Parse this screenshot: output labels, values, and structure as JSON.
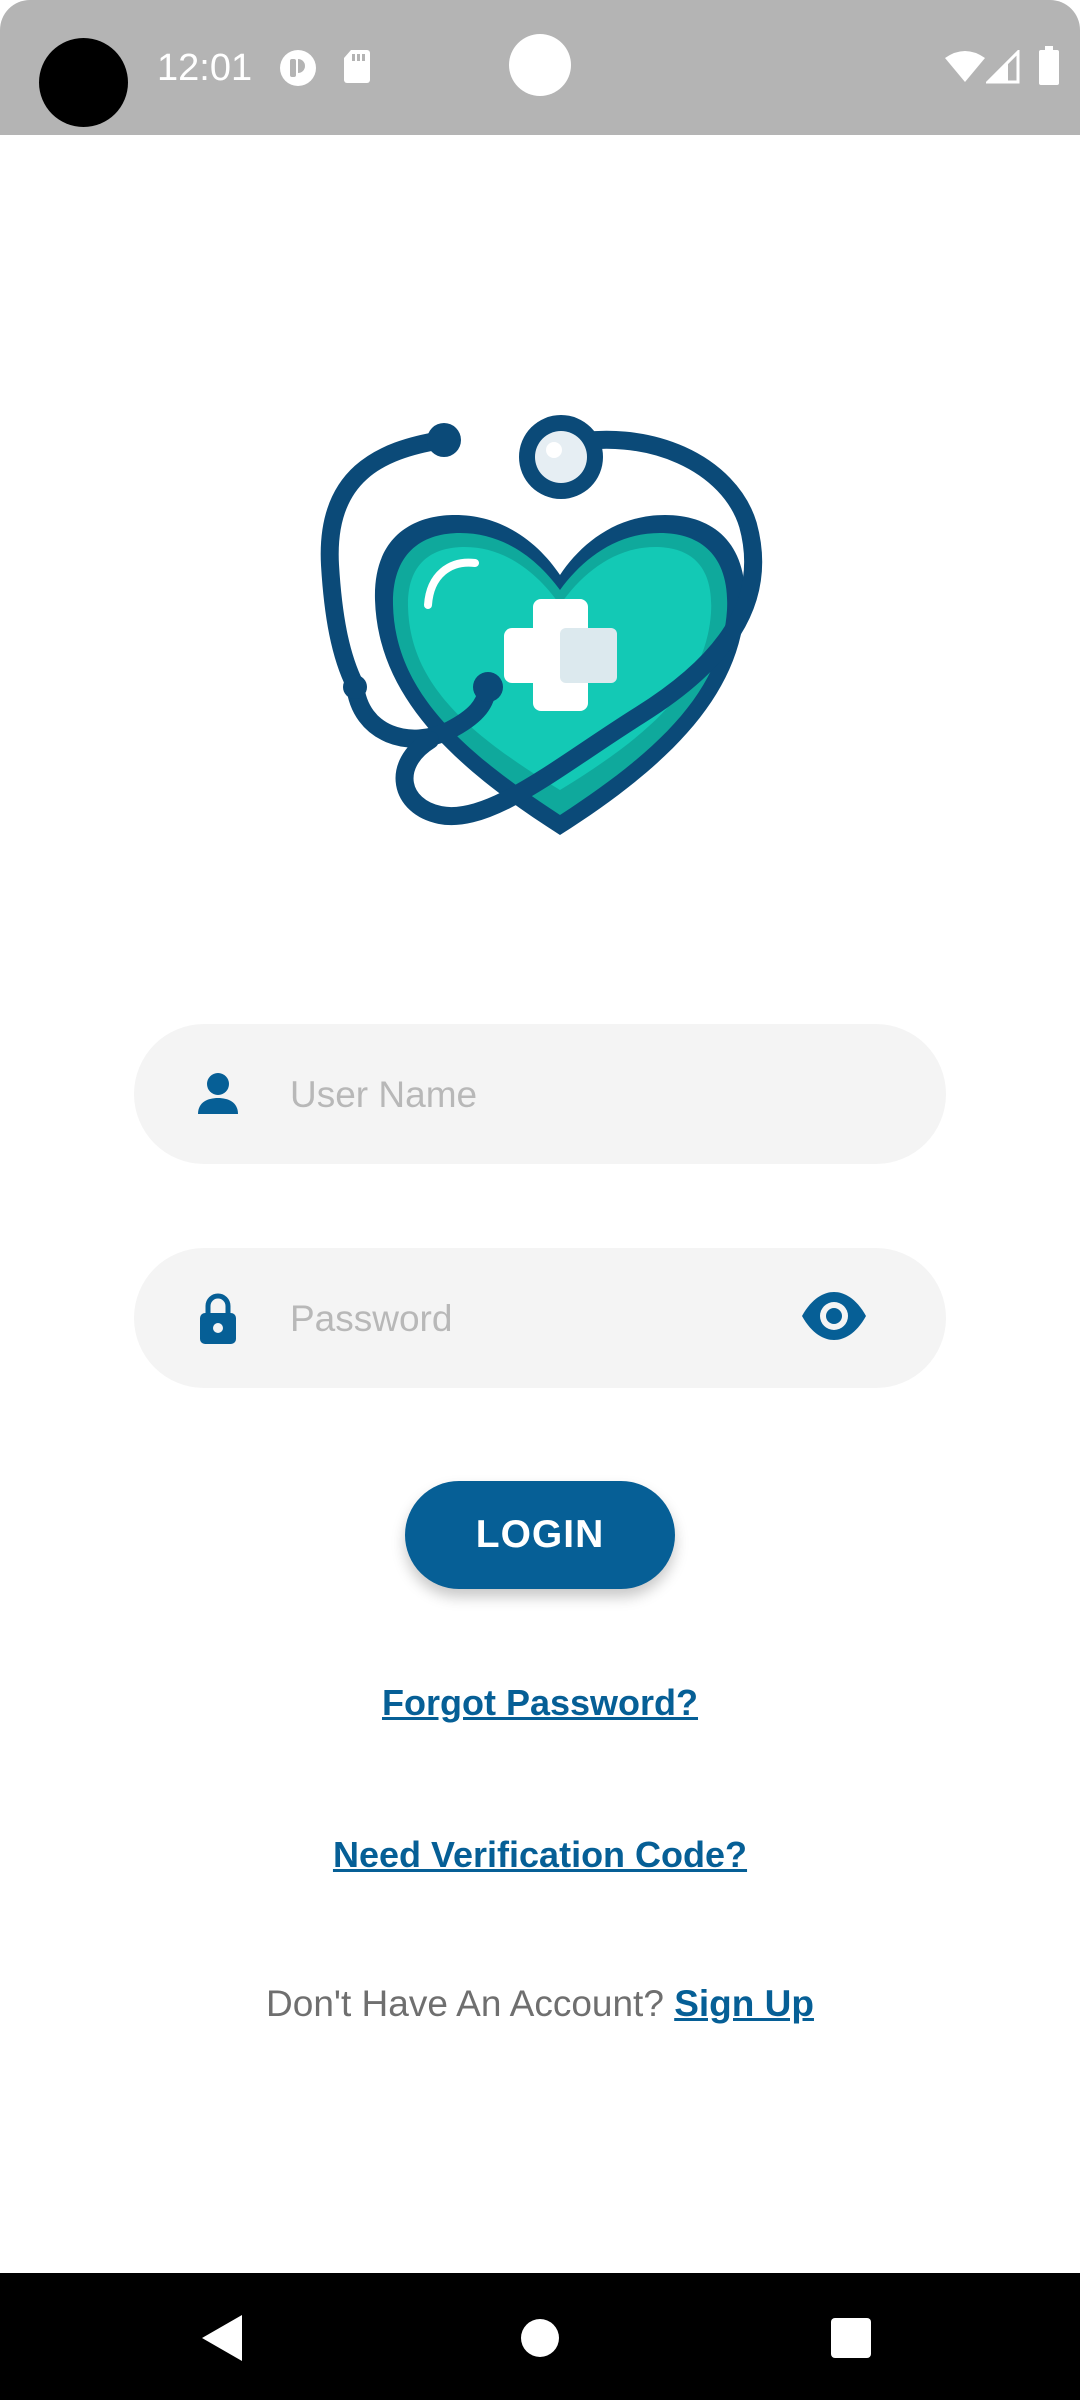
{
  "status_bar": {
    "time": "12:01",
    "icons": [
      "notification-icon",
      "sd-card-icon",
      "wifi-icon",
      "cellular-signal-icon",
      "battery-icon"
    ]
  },
  "logo": {
    "icon": "heart-stethoscope-medical-cross-logo",
    "colors": {
      "heart": "#13c4b2",
      "outline": "#0b4a78",
      "cross": "#ffffff"
    }
  },
  "form": {
    "username": {
      "placeholder": "User Name",
      "value": "",
      "icon": "person-icon"
    },
    "password": {
      "placeholder": "Password",
      "value": "",
      "icon": "lock-icon",
      "toggle_icon": "eye-icon"
    },
    "login_label": "LOGIN"
  },
  "links": {
    "forgot_password": "Forgot Password?",
    "verification_code": "Need Verification Code?",
    "no_account_text": "Don't Have An Account?",
    "sign_up": "Sign Up"
  },
  "nav_bar": {
    "buttons": [
      "back-icon",
      "home-icon",
      "recents-icon"
    ]
  },
  "theme": {
    "primary": "#065f96",
    "field_background": "#f4f4f4",
    "placeholder": "#b8b8b8",
    "muted_text": "#6f6f6f"
  }
}
